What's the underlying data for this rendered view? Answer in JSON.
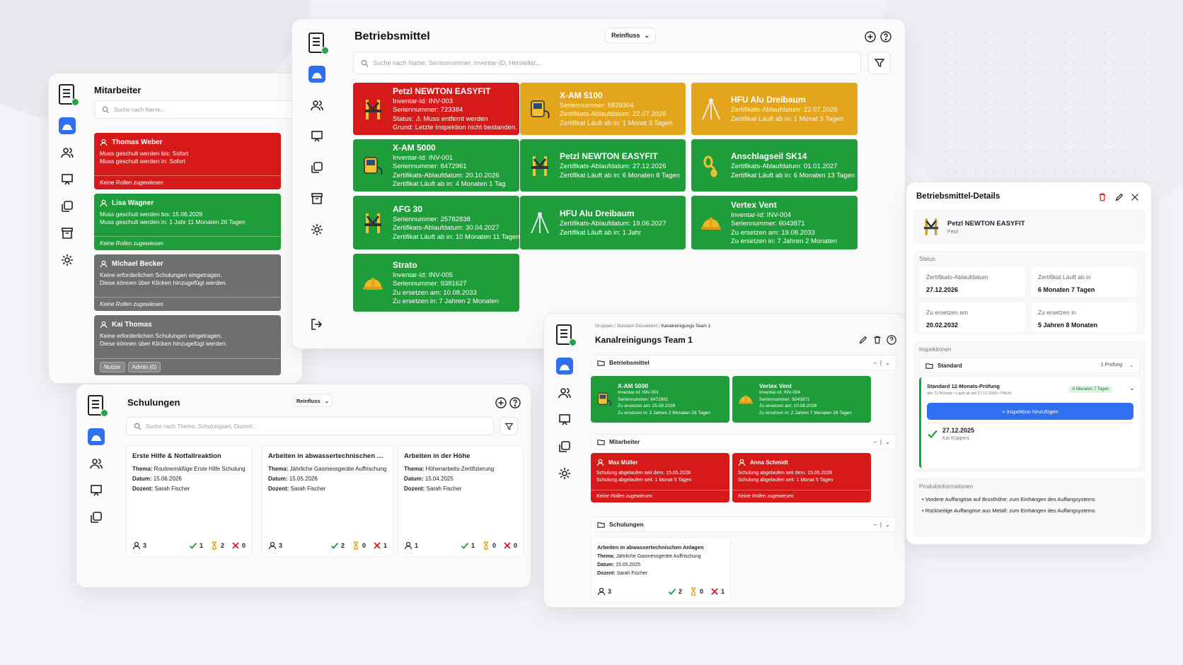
{
  "mitarbeiter": {
    "title": "Mitarbeiter",
    "search_placeholder": "Suche nach Name...",
    "employees": [
      {
        "name": "Thomas Weber",
        "line1": "Muss geschult werden bis: Sofort",
        "line2": "Muss geschult werden in: Sofort",
        "footer": "Keine Rollen zugewiesen",
        "status": "red"
      },
      {
        "name": "Lisa Wagner",
        "line1": "Muss geschult werden bis: 15.06.2028",
        "line2": "Muss geschult werden in: 1 Jahr 11 Monaten 26 Tagen",
        "footer": "Keine Rollen zugewiesen",
        "status": "green"
      },
      {
        "name": "Michael Becker",
        "line1": "Keine erforderlichen Schulungen eingetragen.",
        "line2": "Diese können über Klicken hinzugefügt werden.",
        "footer": "Keine Rollen zugewiesen",
        "status": "gray"
      },
      {
        "name": "Kai Thomas",
        "line1": "Keine erforderlichen Schulungen eingetragen.",
        "line2": "Diese können über Klicken hinzugefügt werden.",
        "tags": [
          "Nutzer",
          "Admin (0)"
        ],
        "status": "gray"
      }
    ]
  },
  "betriebsmittel": {
    "title": "Betriebsmittel",
    "dropdown": "Reinfluss",
    "search_placeholder": "Suche nach Name, Seriennummer, Inventar-ID, Hersteller...",
    "cards": [
      {
        "name": "Petzl NEWTON EASYFIT",
        "lines": [
          "Inventar-Id: INV-003",
          "Seriennummer: 723384",
          "Status: ⚠ Muss entfernt werden",
          "Grund: Letzte Inspektion nicht bestanden."
        ],
        "color": "red",
        "icon": "harness-icon"
      },
      {
        "name": "X-AM 5100",
        "lines": [
          "Seriennummer: 5829304",
          "Zertifikats-Ablaufdatum: 22.07.2026",
          "Zertifikat Läuft ab in: 1 Monat 3 Tagen"
        ],
        "color": "amber",
        "icon": "gas-detector-icon"
      },
      {
        "name": "HFU Alu Dreibaum",
        "lines": [
          "Zertifikats-Ablaufdatum: 22.07.2026",
          "Zertifikat Läuft ab in: 1 Monat 3 Tagen"
        ],
        "color": "amber",
        "icon": "tripod-icon"
      },
      {
        "name": "X-AM 5000",
        "lines": [
          "Inventar-Id: INV-001",
          "Seriennummer: 8472961",
          "Zertifikats-Ablaufdatum: 20.10.2026",
          "Zertifikat Läuft ab in: 4 Monaten 1 Tag"
        ],
        "color": "green",
        "icon": "gas-detector-icon"
      },
      {
        "name": "Petzl NEWTON EASYFIT",
        "lines": [
          "Zertifikats-Ablaufdatum: 27.12.2026",
          "Zertifikat Läuft ab in: 6 Monaten 8 Tagen"
        ],
        "color": "green",
        "icon": "harness-icon"
      },
      {
        "name": "Anschlagseil SK14",
        "lines": [
          "Zertifikats-Ablaufdatum: 01.01.2027",
          "Zertifikat Läuft ab in: 6 Monaten 13 Tagen"
        ],
        "color": "green",
        "icon": "rope-icon"
      },
      {
        "name": "AFG 30",
        "lines": [
          "Seriennummer: 25782838",
          "Zertifikats-Ablaufdatum: 30.04.2027",
          "Zertifikat Läuft ab in: 10 Monaten 11 Tagen"
        ],
        "color": "green",
        "icon": "harness-icon"
      },
      {
        "name": "HFU Alu Dreibaum",
        "lines": [
          "Zertifikats-Ablaufdatum: 19.06.2027",
          "Zertifikat Läuft ab in: 1 Jahr"
        ],
        "color": "green",
        "icon": "tripod-icon"
      },
      {
        "name": "Vertex Vent",
        "lines": [
          "Inventar-Id: INV-004",
          "Seriennummer: 6043871",
          "Zu ersetzen am: 19.08.2033",
          "Zu ersetzen in: 7 Jahren 2 Monaten"
        ],
        "color": "green",
        "icon": "helmet-icon"
      },
      {
        "name": "Strato",
        "lines": [
          "Inventar-Id: INV-005",
          "Seriennummer: 9381627",
          "Zu ersetzen am: 10.08.2033",
          "Zu ersetzen in: 7 Jahren 2 Monaten"
        ],
        "color": "green",
        "icon": "helmet-icon"
      }
    ]
  },
  "schulungen": {
    "title": "Schulungen",
    "dropdown": "Reinfluss",
    "search_placeholder": "Suche nach Thema, Schulungsart, Dozent...",
    "items": [
      {
        "title": "Erste Hilfe & Notfallreaktion",
        "thema": "Routinemäßige Erste Hilfe Schulung",
        "datum": "15.06.2026",
        "dozent": "Sarah Fischer",
        "people": "3",
        "ok": "1",
        "pending": "2",
        "fail": "0"
      },
      {
        "title": "Arbeiten in abwassertechnischen Anlag...",
        "thema": "Jährliche Gasmessgeräte Auffrischung",
        "datum": "15.05.2026",
        "dozent": "Sarah Fischer",
        "people": "3",
        "ok": "2",
        "pending": "0",
        "fail": "1"
      },
      {
        "title": "Arbeiten in der Höhe",
        "thema": "Höhenarbeits-Zertifizierung",
        "datum": "15.04.2025",
        "dozent": "Sarah Fischer",
        "people": "1",
        "ok": "1",
        "pending": "0",
        "fail": "0"
      }
    ],
    "labels": {
      "thema": "Thema:",
      "datum": "Datum:",
      "dozent": "Dozent:"
    }
  },
  "gruppe": {
    "breadcrumb_prefix": "Gruppen / Standort Düsseldorf / ",
    "breadcrumb_current": "Kanalreinigungs Team 1",
    "title": "Kanalreinigungs Team 1",
    "sections": {
      "betriebsmittel": "Betriebsmittel",
      "mitarbeiter": "Mitarbeiter",
      "schulungen": "Schulungen"
    },
    "equipment": [
      {
        "name": "X-AM 5000",
        "lines": [
          "Inventar-Id: INV-001",
          "Seriennummer: 8472961",
          "Zu ersetzen am: 25.08.2028",
          "Zu ersetzen in: 2 Jahren 2 Monaten 26 Tagen"
        ]
      },
      {
        "name": "Vertex Vent",
        "lines": [
          "Inventar-Id: INV-004",
          "Seriennummer: 6043871",
          "Zu ersetzen am: 10.08.2039",
          "Zu ersetzen in: 2 Jahren 7 Monaten 26 Tagen"
        ]
      }
    ],
    "employees": [
      {
        "name": "Max Müller",
        "line1": "Schulung abgelaufen seit dem: 15.05.2026",
        "line2": "Schulung abgelaufen seit: 1 Monat 5 Tagen",
        "footer": "Keine Rollen zugewiesen"
      },
      {
        "name": "Anna Schmidt",
        "line1": "Schulung abgelaufen seit dem: 15.05.2026",
        "line2": "Schulung abgelaufen seit: 1 Monat 5 Tagen",
        "footer": "Keine Rollen zugewiesen"
      }
    ],
    "training": {
      "title": "Arbeiten in abwassertechnischen Anlagen",
      "thema": "Jährliche Gasmessgeräte Auffrischung",
      "datum": "15.05.2025",
      "dozent": "Sarah Fischer",
      "people": "3",
      "ok": "2",
      "pending": "0",
      "fail": "1"
    }
  },
  "details": {
    "title": "Betriebsmittel-Details",
    "product": "Petzl NEWTON EASYFIT",
    "brand": "Petzl",
    "status_label": "Status",
    "boxes": [
      {
        "k": "Zertifikats-Ablaufdatum",
        "v": "27.12.2026"
      },
      {
        "k": "Zertifikat Läuft ab in",
        "v": "6 Monaten 7 Tagen"
      },
      {
        "k": "Zu ersetzen am",
        "v": "20.02.2032"
      },
      {
        "k": "Zu ersetzen in",
        "v": "5 Jahren 8 Monaten"
      }
    ],
    "inspections_label": "Inspektionen",
    "standard": "Standard",
    "pruefung_count": "1 Prüfung",
    "plan_title": "Standard 12-Monats-Prüfung",
    "plan_sub": "alle 12 Monate • Läuft ab am 27.12.2026 • Pflicht",
    "plan_badge": "6 Monaten 7 Tagen",
    "add_button": "+ Inspektion hinzufügen",
    "inspection_date": "27.12.2025",
    "inspector": "Kai Küppers",
    "info_label": "Produktinformationen",
    "info": [
      "• Vordere Auffangöse auf Brusthöhe: zum Einhängen des Auffangsystems",
      "• Rückseitige Auffangöse aus Metall: zum Einhängen des Auffangsystems"
    ]
  },
  "colors": {
    "red": "#d61a1a",
    "green": "#1f9d3a",
    "amber": "#e3a51c",
    "gray": "#6f6f6f",
    "accent": "#2f6ff0"
  }
}
